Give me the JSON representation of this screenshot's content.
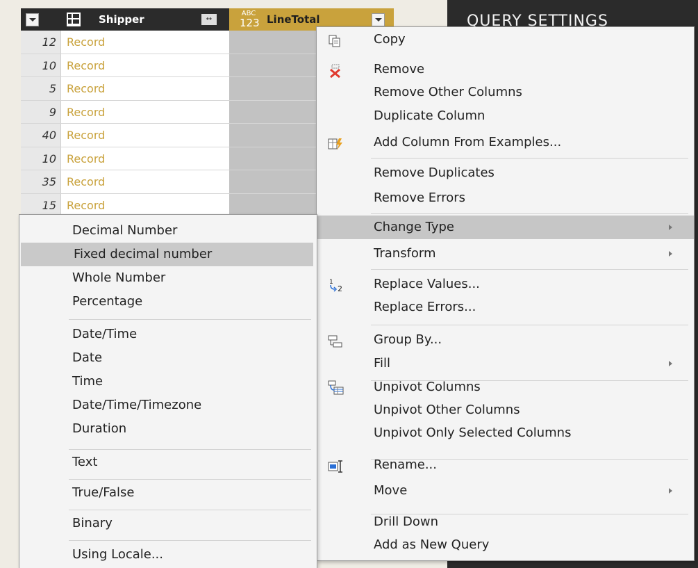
{
  "grid": {
    "header": {
      "column1_title": "Shipper",
      "column2_type_top": "ABC",
      "column2_type_bottom": "123",
      "column2_title": "LineTotal",
      "expand_glyph": "↔"
    },
    "rows": [
      {
        "index": "12",
        "value": "Record"
      },
      {
        "index": "10",
        "value": "Record"
      },
      {
        "index": "5",
        "value": "Record"
      },
      {
        "index": "9",
        "value": "Record"
      },
      {
        "index": "40",
        "value": "Record"
      },
      {
        "index": "10",
        "value": "Record"
      },
      {
        "index": "35",
        "value": "Record"
      },
      {
        "index": "15",
        "value": "Record"
      }
    ]
  },
  "settings_panel": {
    "title": "QUERY SETTINGS"
  },
  "context_menu": {
    "items": [
      {
        "label": "Copy",
        "icon": "copy-icon"
      },
      {
        "label": "Remove",
        "icon": "remove-column-icon"
      },
      {
        "label": "Remove Other Columns"
      },
      {
        "label": "Duplicate Column"
      },
      {
        "label": "Add Column From Examples...",
        "icon": "add-column-examples-icon"
      },
      {
        "label": "Remove Duplicates"
      },
      {
        "label": "Remove Errors"
      },
      {
        "label": "Change Type",
        "submenu": true,
        "highlighted": true
      },
      {
        "label": "Transform",
        "submenu": true
      },
      {
        "label": "Replace Values...",
        "icon": "replace-values-icon"
      },
      {
        "label": "Replace Errors..."
      },
      {
        "label": "Group By...",
        "icon": "group-by-icon"
      },
      {
        "label": "Fill",
        "submenu": true
      },
      {
        "label": "Unpivot Columns",
        "icon": "unpivot-icon"
      },
      {
        "label": "Unpivot Other Columns"
      },
      {
        "label": "Unpivot Only Selected Columns"
      },
      {
        "label": "Rename...",
        "icon": "rename-icon"
      },
      {
        "label": "Move",
        "submenu": true
      },
      {
        "label": "Drill Down"
      },
      {
        "label": "Add as New Query"
      }
    ]
  },
  "change_type_submenu": {
    "items": [
      {
        "label": "Decimal Number"
      },
      {
        "label": "Fixed decimal number",
        "highlighted": true
      },
      {
        "label": "Whole Number"
      },
      {
        "label": "Percentage"
      },
      {
        "label": "Date/Time"
      },
      {
        "label": "Date"
      },
      {
        "label": "Time"
      },
      {
        "label": "Date/Time/Timezone"
      },
      {
        "label": "Duration"
      },
      {
        "label": "Text"
      },
      {
        "label": "True/False"
      },
      {
        "label": "Binary"
      },
      {
        "label": "Using Locale..."
      }
    ]
  },
  "colors": {
    "selected_column": "#c9a23c",
    "record_text": "#c9a23c",
    "dark_panel": "#2b2b2b",
    "menu_highlight": "#c6c6c6",
    "remove_icon": "#e03a2f"
  }
}
